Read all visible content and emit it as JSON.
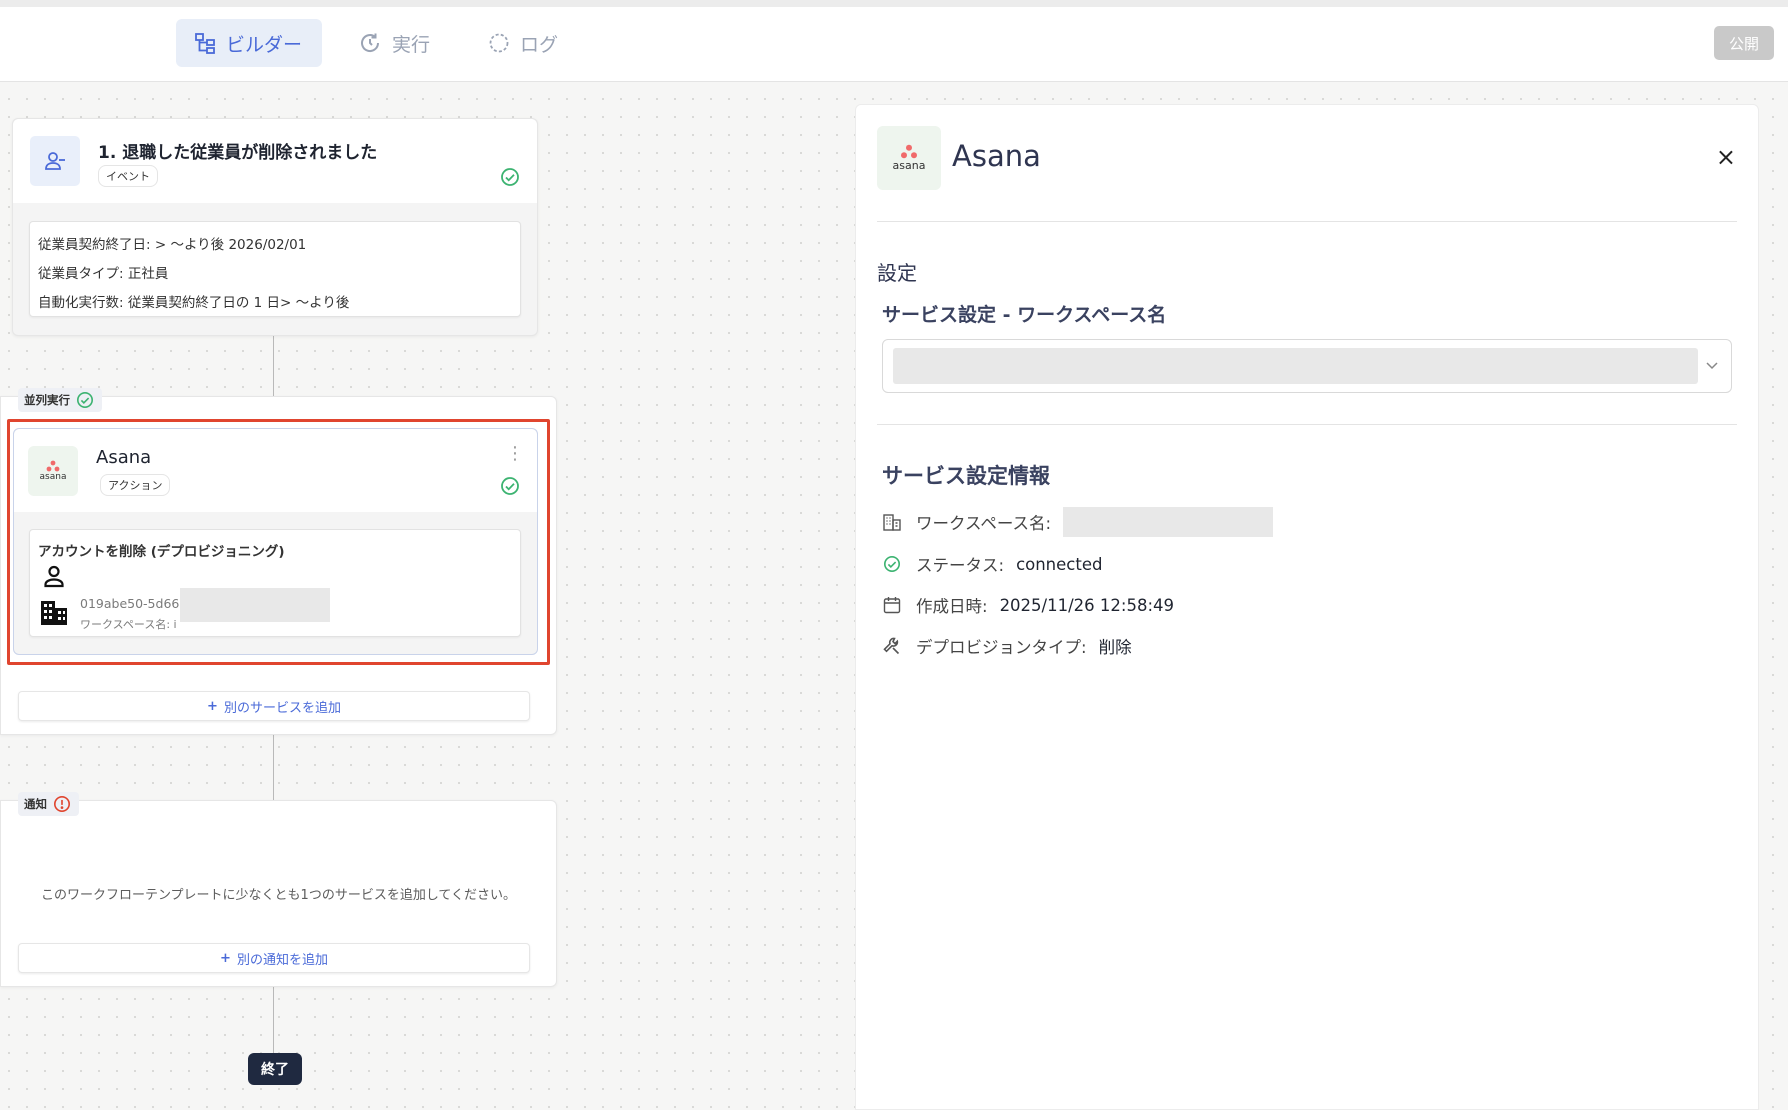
{
  "tabs": [
    {
      "label": "ビルダー",
      "active": true
    },
    {
      "label": "実行",
      "active": false
    },
    {
      "label": "ログ",
      "active": false
    }
  ],
  "publish_label": "公開",
  "event": {
    "title": "1. 退職した従業員が削除されました",
    "chip": "イベント",
    "conditions": [
      "従業員契約終了日: > 〜より後 2026/02/01",
      "従業員タイプ: 正社員",
      "自動化実行数: 従業員契約終了日の 1 日> 〜より後"
    ]
  },
  "parallel": {
    "label": "並列実行",
    "action": {
      "title": "Asana",
      "logo_text": "asana",
      "chip": "アクション",
      "operation": "アカウントを削除 (デプロビジョニング)",
      "account_id": "019abe50-5d66",
      "workspace_label": "ワークスペース名: i"
    },
    "add_service_label": "別のサービスを追加"
  },
  "notify": {
    "label": "通知",
    "empty_message": "このワークフローテンプレートに少なくとも1つのサービスを追加してください。",
    "add_notify_label": "別の通知を追加"
  },
  "end_label": "終了",
  "panel": {
    "title": "Asana",
    "logo_text": "asana",
    "close_icon": "×",
    "settings_heading": "設定",
    "service_field_label": "サービス設定 - ワークスペース名",
    "info_heading": "サービス設定情報",
    "info_rows": [
      {
        "icon": "building-icon",
        "label": "ワークスペース名:",
        "value": ""
      },
      {
        "icon": "check-circle-icon",
        "label": "ステータス:",
        "value": "connected"
      },
      {
        "icon": "calendar-icon",
        "label": "作成日時:",
        "value": "2025/11/26 12:58:49"
      },
      {
        "icon": "wrench-icon",
        "label": "デプロビジョンタイプ:",
        "value": "削除"
      }
    ]
  },
  "colors": {
    "accent": "#4a6ad8",
    "success": "#3cb371",
    "error": "#e0452f",
    "asana": "#f06a6a",
    "highlight": "#e0452f"
  }
}
